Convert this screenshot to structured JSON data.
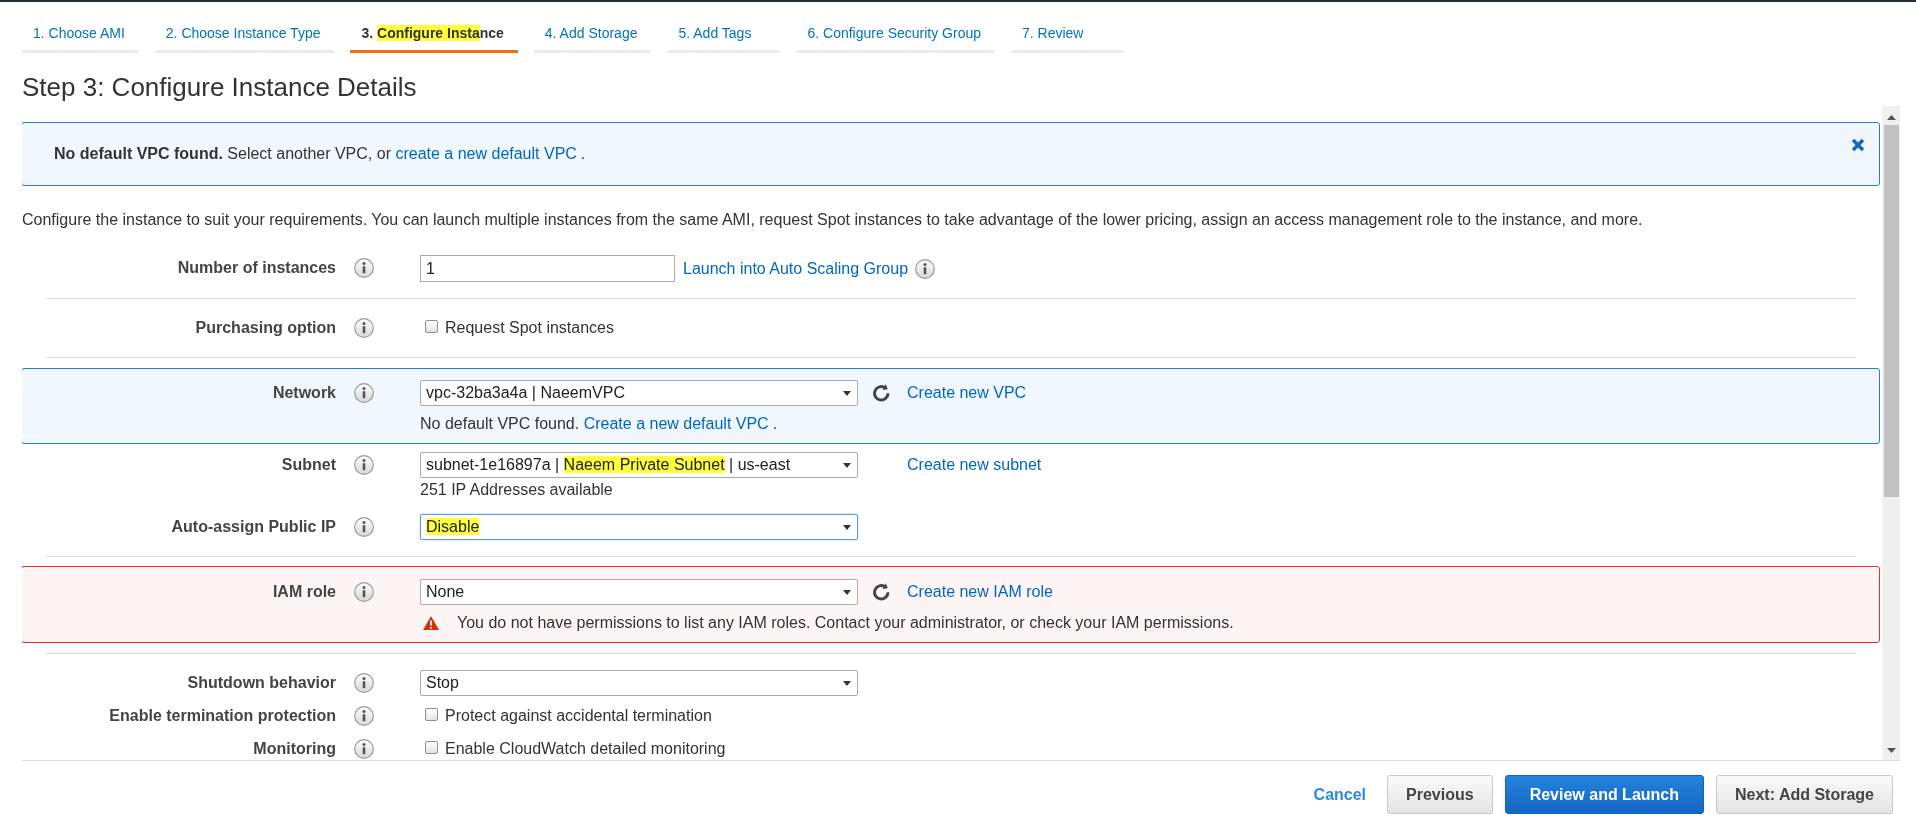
{
  "tabs": [
    {
      "parts": [
        {
          "text": "1. Choose AMI",
          "highlighted": false
        }
      ],
      "selected": false
    },
    {
      "parts": [
        {
          "text": "2. Choose Instance Type",
          "highlighted": false
        }
      ],
      "selected": false
    },
    {
      "parts": [
        {
          "text": "3. ",
          "highlighted": false
        },
        {
          "text": "Configure Insta",
          "highlighted": true
        },
        {
          "text": "nce",
          "highlighted": false
        }
      ],
      "selected": true
    },
    {
      "parts": [
        {
          "text": "4. Add Storage",
          "highlighted": false
        }
      ],
      "selected": false
    },
    {
      "parts": [
        {
          "text": "5. Add Tags",
          "highlighted": false
        }
      ],
      "selected": false
    },
    {
      "parts": [
        {
          "text": "6. Configure Security Group",
          "highlighted": false
        }
      ],
      "selected": false
    },
    {
      "parts": [
        {
          "text": "7. Review",
          "highlighted": false
        }
      ],
      "selected": false
    }
  ],
  "heading": "Step 3: Configure Instance Details",
  "alert": {
    "message": "**No default VPC found.** Select another VPC, or",
    "link": "create a new default VPC",
    "suffix": "."
  },
  "description": "Configure the instance to suit your requirements. You can launch multiple instances from the same AMI, request Spot instances to take advantage of the lower pricing, assign an access management role to the instance, and more.",
  "sections": [
    {
      "kind": "plain",
      "divider_after": true,
      "rows": [
        {
          "kind": "input",
          "label": "Number of instances",
          "value": "1",
          "link": "Launch into Auto Scaling Group",
          "link_info": true
        }
      ]
    },
    {
      "kind": "plain",
      "divider_after": true,
      "rows": [
        {
          "kind": "checkbox",
          "label": "Purchasing option",
          "option": "Request Spot instances",
          "checked": false
        }
      ]
    },
    {
      "kind": "info",
      "divider_after": false,
      "rows": [
        {
          "kind": "select",
          "label": "Network",
          "value": [
            {
              "text": "vpc-32ba3a4a | NaeemVPC",
              "highlighted": false
            }
          ],
          "focused": false,
          "refresh": true,
          "link": "Create new VPC",
          "note": {
            "text": "No default VPC found.",
            "link": "Create a new default VPC",
            "suffix": "."
          }
        }
      ]
    },
    {
      "kind": "plain",
      "divider_after": true,
      "rows": [
        {
          "kind": "select",
          "label": "Subnet",
          "value": [
            {
              "text": "subnet-1e16897a | ",
              "highlighted": false
            },
            {
              "text": "Naeem Private Subnet",
              "highlighted": true
            },
            {
              "text": " | us-east",
              "highlighted": false
            }
          ],
          "focused": false,
          "refresh": false,
          "link": "Create new subnet",
          "note": {
            "text": "251 IP Addresses available"
          }
        },
        {
          "kind": "select",
          "label": "Auto-assign Public IP",
          "value": [
            {
              "text": "Disable",
              "highlighted": true
            }
          ],
          "focused": true,
          "refresh": false
        }
      ]
    },
    {
      "kind": "error",
      "divider_after": true,
      "rows": [
        {
          "kind": "select",
          "label": "IAM role",
          "value": [
            {
              "text": "None",
              "highlighted": false
            }
          ],
          "focused": false,
          "refresh": true,
          "link": "Create new IAM role",
          "warning": "You do not have permissions to list any IAM roles. Contact your administrator, or check your IAM permissions."
        }
      ]
    },
    {
      "kind": "plain",
      "divider_after": false,
      "rows": [
        {
          "kind": "select",
          "label": "Shutdown behavior",
          "value": [
            {
              "text": "Stop",
              "highlighted": false
            }
          ],
          "focused": false,
          "refresh": false
        },
        {
          "kind": "checkbox",
          "label": "Enable termination protection",
          "option": "Protect against accidental termination",
          "checked": false
        },
        {
          "kind": "checkbox",
          "label": "Monitoring",
          "option": "Enable CloudWatch detailed monitoring",
          "checked": false
        }
      ]
    }
  ],
  "footer": {
    "cancel": "Cancel",
    "buttons": [
      {
        "label": "Previous",
        "primary": false
      },
      {
        "label": "Review and Launch",
        "primary": true
      },
      {
        "label": "Next: Add Storage",
        "primary": false
      }
    ]
  }
}
